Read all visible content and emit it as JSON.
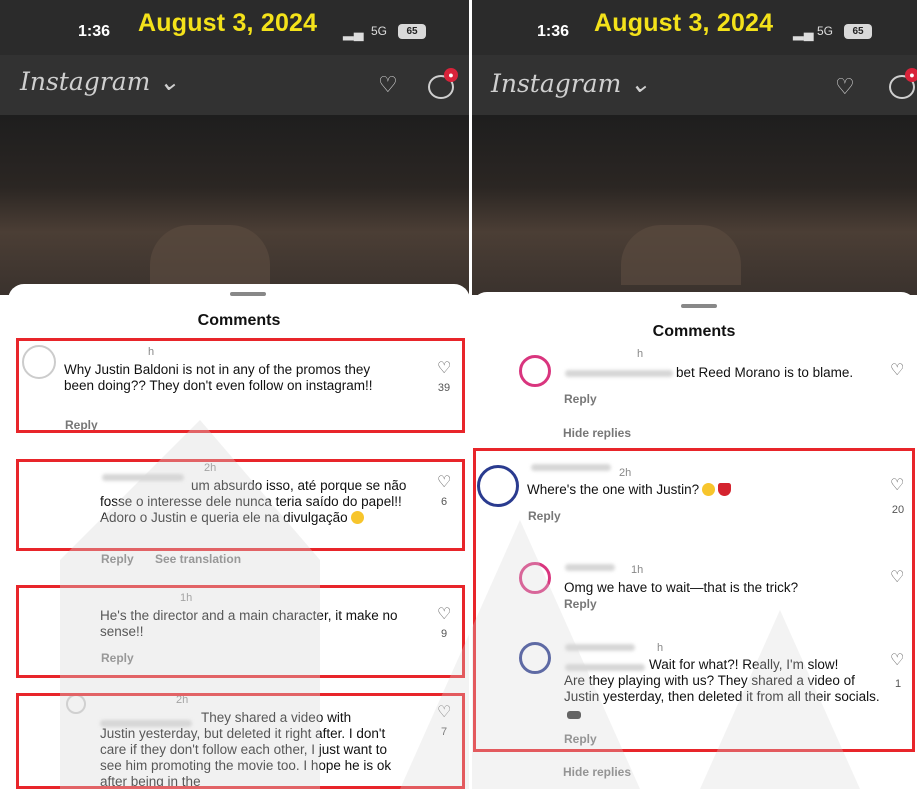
{
  "left": {
    "status": {
      "time": "1:36",
      "date": "August 3, 2024",
      "network": "5G",
      "battery": "65"
    },
    "header": {
      "logo": "Instagram ⌄"
    },
    "sheet_title": "Comments",
    "comments": [
      {
        "age": "h",
        "text": "Why Justin Baldoni is not in any of the promos they been doing?? They don't even follow on instagram!!",
        "likes": "39",
        "reply": "Reply"
      },
      {
        "age": "2h",
        "text": "um absurdo isso, até porque se não fosse o interesse dele nunca teria saído do papel!! Adoro o Justin e queria ele na divulgação",
        "likes": "6",
        "reply": "Reply",
        "translate": "See translation"
      },
      {
        "age": "1h",
        "text": "He's the director and a main character, it make no sense!!",
        "likes": "9",
        "reply": "Reply"
      },
      {
        "age": "2h",
        "text_line1": "They shared a video with",
        "text_rest": "Justin yesterday, but deleted it right after. I don't care if they don't follow each other, I just want to see him promoting the movie too. I hope he is ok after being in the",
        "likes": "7"
      }
    ]
  },
  "right": {
    "status": {
      "time": "1:36",
      "date": "August 3, 2024",
      "network": "5G",
      "battery": "65"
    },
    "header": {
      "logo": "Instagram ⌄"
    },
    "sheet_title": "Comments",
    "top_reply": {
      "age": "h",
      "text": "bet Reed Morano is to blame.",
      "reply": "Reply",
      "hide_replies": "Hide replies"
    },
    "thread": [
      {
        "age": "2h",
        "text": "Where's the one with Justin?",
        "likes": "20",
        "reply": "Reply"
      },
      {
        "age": "1h",
        "text": "Omg we have to wait—that is the trick?",
        "reply": "Reply"
      },
      {
        "age": "h",
        "text_line1": "Wait for what?! Really, I'm slow!",
        "text_rest": "Are they playing with us? They shared a video of Justin yesterday, then deleted it from all their socials.",
        "likes": "1",
        "reply": "Reply"
      }
    ],
    "bottom_hide_replies": "Hide replies"
  }
}
